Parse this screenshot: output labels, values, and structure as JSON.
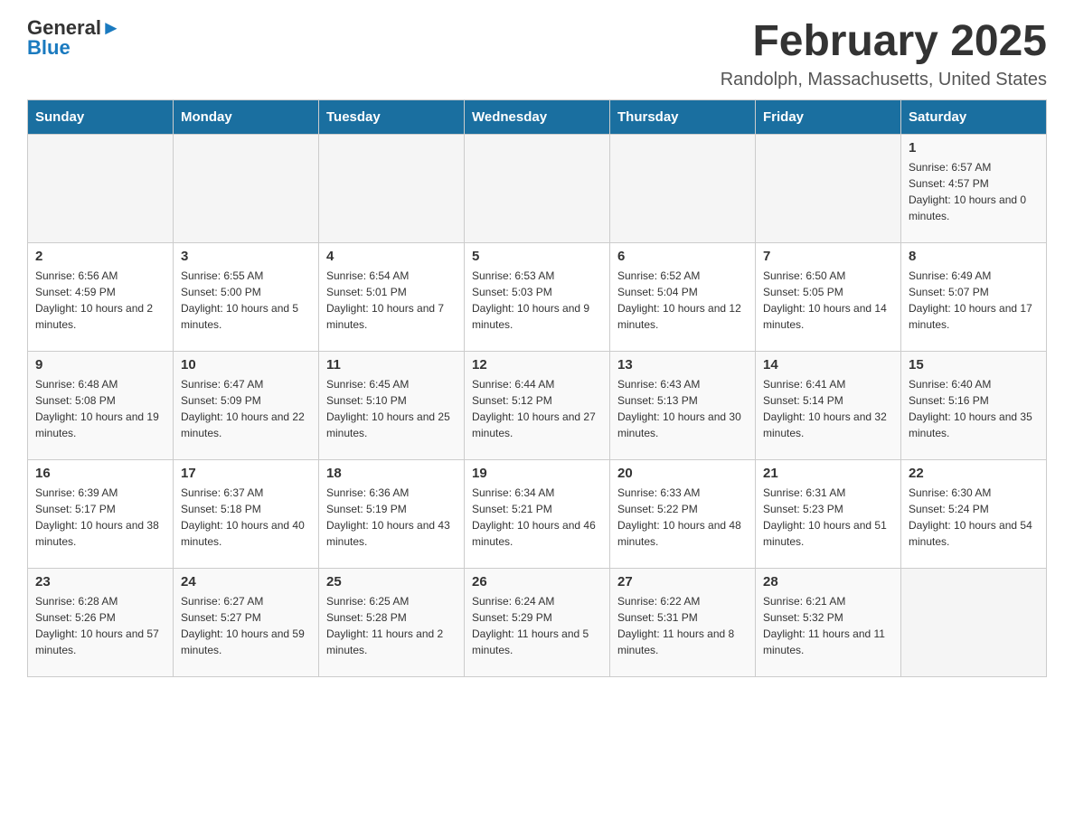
{
  "header": {
    "logo_general": "General",
    "logo_blue": "Blue",
    "month_title": "February 2025",
    "location": "Randolph, Massachusetts, United States"
  },
  "weekdays": [
    "Sunday",
    "Monday",
    "Tuesday",
    "Wednesday",
    "Thursday",
    "Friday",
    "Saturday"
  ],
  "weeks": [
    [
      {
        "day": "",
        "info": ""
      },
      {
        "day": "",
        "info": ""
      },
      {
        "day": "",
        "info": ""
      },
      {
        "day": "",
        "info": ""
      },
      {
        "day": "",
        "info": ""
      },
      {
        "day": "",
        "info": ""
      },
      {
        "day": "1",
        "info": "Sunrise: 6:57 AM\nSunset: 4:57 PM\nDaylight: 10 hours and 0 minutes."
      }
    ],
    [
      {
        "day": "2",
        "info": "Sunrise: 6:56 AM\nSunset: 4:59 PM\nDaylight: 10 hours and 2 minutes."
      },
      {
        "day": "3",
        "info": "Sunrise: 6:55 AM\nSunset: 5:00 PM\nDaylight: 10 hours and 5 minutes."
      },
      {
        "day": "4",
        "info": "Sunrise: 6:54 AM\nSunset: 5:01 PM\nDaylight: 10 hours and 7 minutes."
      },
      {
        "day": "5",
        "info": "Sunrise: 6:53 AM\nSunset: 5:03 PM\nDaylight: 10 hours and 9 minutes."
      },
      {
        "day": "6",
        "info": "Sunrise: 6:52 AM\nSunset: 5:04 PM\nDaylight: 10 hours and 12 minutes."
      },
      {
        "day": "7",
        "info": "Sunrise: 6:50 AM\nSunset: 5:05 PM\nDaylight: 10 hours and 14 minutes."
      },
      {
        "day": "8",
        "info": "Sunrise: 6:49 AM\nSunset: 5:07 PM\nDaylight: 10 hours and 17 minutes."
      }
    ],
    [
      {
        "day": "9",
        "info": "Sunrise: 6:48 AM\nSunset: 5:08 PM\nDaylight: 10 hours and 19 minutes."
      },
      {
        "day": "10",
        "info": "Sunrise: 6:47 AM\nSunset: 5:09 PM\nDaylight: 10 hours and 22 minutes."
      },
      {
        "day": "11",
        "info": "Sunrise: 6:45 AM\nSunset: 5:10 PM\nDaylight: 10 hours and 25 minutes."
      },
      {
        "day": "12",
        "info": "Sunrise: 6:44 AM\nSunset: 5:12 PM\nDaylight: 10 hours and 27 minutes."
      },
      {
        "day": "13",
        "info": "Sunrise: 6:43 AM\nSunset: 5:13 PM\nDaylight: 10 hours and 30 minutes."
      },
      {
        "day": "14",
        "info": "Sunrise: 6:41 AM\nSunset: 5:14 PM\nDaylight: 10 hours and 32 minutes."
      },
      {
        "day": "15",
        "info": "Sunrise: 6:40 AM\nSunset: 5:16 PM\nDaylight: 10 hours and 35 minutes."
      }
    ],
    [
      {
        "day": "16",
        "info": "Sunrise: 6:39 AM\nSunset: 5:17 PM\nDaylight: 10 hours and 38 minutes."
      },
      {
        "day": "17",
        "info": "Sunrise: 6:37 AM\nSunset: 5:18 PM\nDaylight: 10 hours and 40 minutes."
      },
      {
        "day": "18",
        "info": "Sunrise: 6:36 AM\nSunset: 5:19 PM\nDaylight: 10 hours and 43 minutes."
      },
      {
        "day": "19",
        "info": "Sunrise: 6:34 AM\nSunset: 5:21 PM\nDaylight: 10 hours and 46 minutes."
      },
      {
        "day": "20",
        "info": "Sunrise: 6:33 AM\nSunset: 5:22 PM\nDaylight: 10 hours and 48 minutes."
      },
      {
        "day": "21",
        "info": "Sunrise: 6:31 AM\nSunset: 5:23 PM\nDaylight: 10 hours and 51 minutes."
      },
      {
        "day": "22",
        "info": "Sunrise: 6:30 AM\nSunset: 5:24 PM\nDaylight: 10 hours and 54 minutes."
      }
    ],
    [
      {
        "day": "23",
        "info": "Sunrise: 6:28 AM\nSunset: 5:26 PM\nDaylight: 10 hours and 57 minutes."
      },
      {
        "day": "24",
        "info": "Sunrise: 6:27 AM\nSunset: 5:27 PM\nDaylight: 10 hours and 59 minutes."
      },
      {
        "day": "25",
        "info": "Sunrise: 6:25 AM\nSunset: 5:28 PM\nDaylight: 11 hours and 2 minutes."
      },
      {
        "day": "26",
        "info": "Sunrise: 6:24 AM\nSunset: 5:29 PM\nDaylight: 11 hours and 5 minutes."
      },
      {
        "day": "27",
        "info": "Sunrise: 6:22 AM\nSunset: 5:31 PM\nDaylight: 11 hours and 8 minutes."
      },
      {
        "day": "28",
        "info": "Sunrise: 6:21 AM\nSunset: 5:32 PM\nDaylight: 11 hours and 11 minutes."
      },
      {
        "day": "",
        "info": ""
      }
    ]
  ]
}
